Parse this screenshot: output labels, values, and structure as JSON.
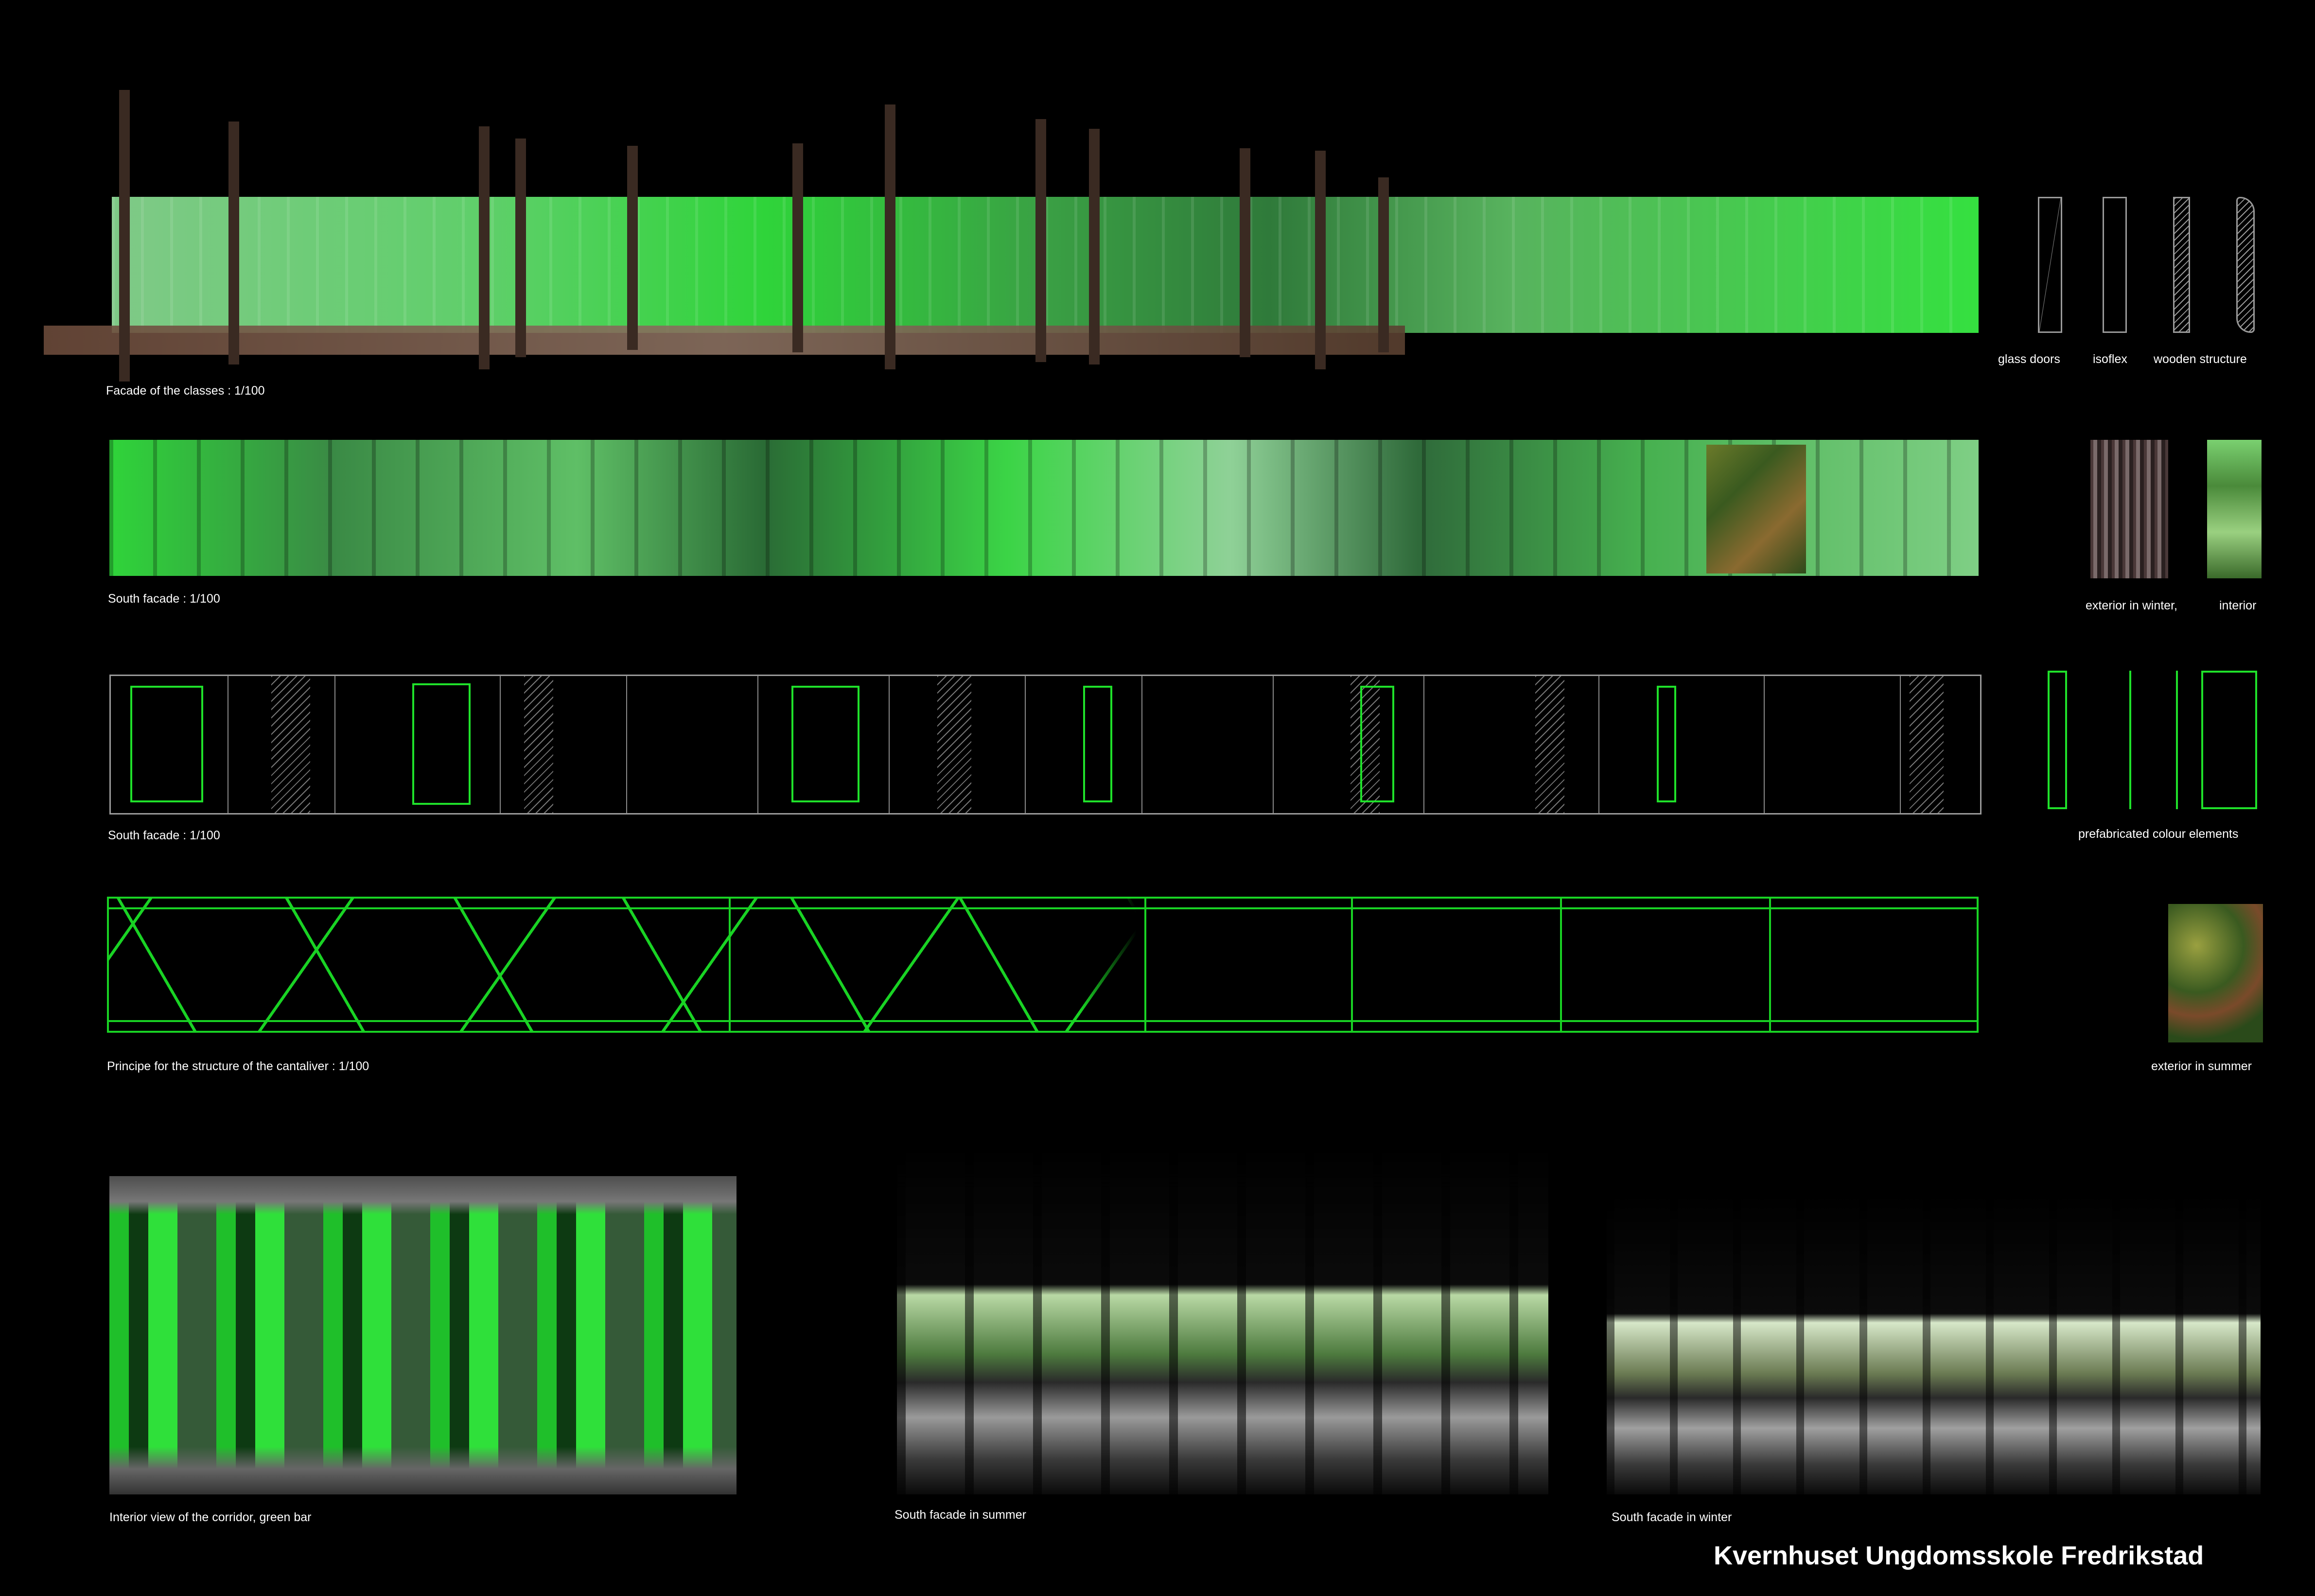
{
  "board_title": "Kvernhuset Ungdomsskole Fredrikstad",
  "rows": {
    "classes_facade": {
      "caption": "Facade of the classes : 1/100"
    },
    "south_facade_render": {
      "caption": "South facade : 1/100"
    },
    "south_facade_outline": {
      "caption": "South facade : 1/100"
    },
    "cantilever": {
      "caption": "Principe for the structure of the cantaliver : 1/100"
    }
  },
  "legend": {
    "materials": [
      "glass doors",
      "isoflex",
      "wooden structure"
    ],
    "seasons_label_a": "exterior in winter,",
    "seasons_label_b": "interior",
    "prefab_label": "prefabricated colour elements",
    "summer_label": "exterior in summer"
  },
  "photos": {
    "corridor": "Interior view of the corridor, green bar",
    "summer": "South facade in summer",
    "winter": "South facade in winter"
  },
  "colors": {
    "accent_green": "#1fe12a",
    "background": "#000000"
  }
}
